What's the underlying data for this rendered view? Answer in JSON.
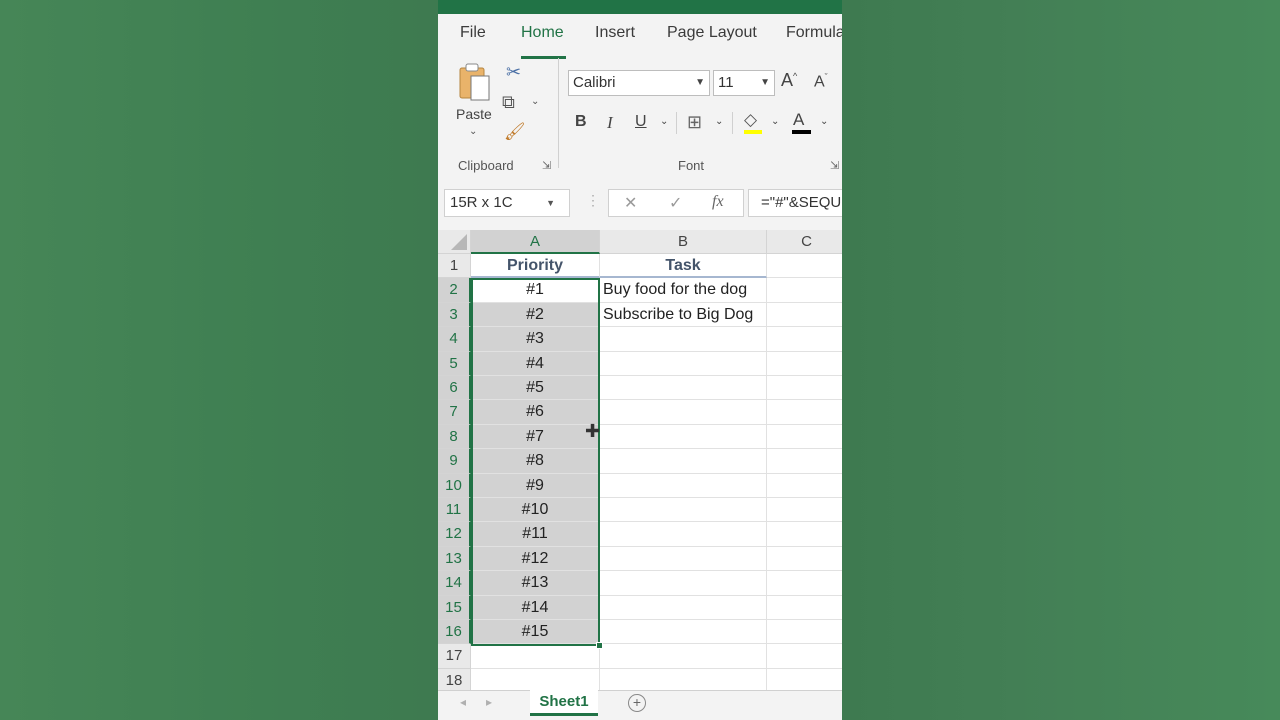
{
  "ribbon": {
    "tabs": [
      "File",
      "Home",
      "Insert",
      "Page Layout",
      "Formula"
    ],
    "active_tab": "Home",
    "clipboard": {
      "paste_label": "Paste",
      "group_label": "Clipboard"
    },
    "font": {
      "name": "Calibri",
      "size": "11",
      "group_label": "Font",
      "bold": "B",
      "italic": "I",
      "underline": "U",
      "font_color_glyph": "A",
      "grow_glyph": "A",
      "shrink_glyph": "A"
    }
  },
  "formula_bar": {
    "name_box": "15R x 1C",
    "fx": "fx",
    "formula": "=\"#\"&SEQU"
  },
  "grid": {
    "columns": [
      "A",
      "B",
      "C"
    ],
    "selected_column": "A",
    "header_row": {
      "a": "Priority",
      "b": "Task"
    },
    "rows": [
      {
        "n": "1",
        "a": "Priority",
        "b": "Task"
      },
      {
        "n": "2",
        "a": "#1",
        "b": "Buy food for the dog"
      },
      {
        "n": "3",
        "a": "#2",
        "b": "Subscribe to Big Dog"
      },
      {
        "n": "4",
        "a": "#3",
        "b": ""
      },
      {
        "n": "5",
        "a": "#4",
        "b": ""
      },
      {
        "n": "6",
        "a": "#5",
        "b": ""
      },
      {
        "n": "7",
        "a": "#6",
        "b": ""
      },
      {
        "n": "8",
        "a": "#7",
        "b": ""
      },
      {
        "n": "9",
        "a": "#8",
        "b": ""
      },
      {
        "n": "10",
        "a": "#9",
        "b": ""
      },
      {
        "n": "11",
        "a": "#10",
        "b": ""
      },
      {
        "n": "12",
        "a": "#11",
        "b": ""
      },
      {
        "n": "13",
        "a": "#12",
        "b": ""
      },
      {
        "n": "14",
        "a": "#13",
        "b": ""
      },
      {
        "n": "15",
        "a": "#14",
        "b": ""
      },
      {
        "n": "16",
        "a": "#15",
        "b": ""
      },
      {
        "n": "17",
        "a": "",
        "b": ""
      },
      {
        "n": "18",
        "a": "",
        "b": ""
      }
    ]
  },
  "sheets": {
    "active": "Sheet1"
  },
  "colors": {
    "accent": "#217346",
    "selection": "#d2d2d2",
    "header_text": "#44546a"
  }
}
